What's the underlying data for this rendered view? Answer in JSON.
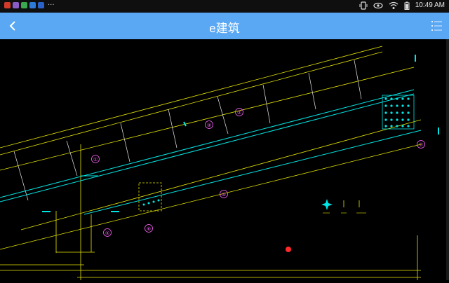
{
  "status_bar": {
    "time": "10:49 AM",
    "overflow": "···",
    "app_icons": [
      "#d23b2a",
      "#8b5cc7",
      "#3aa84f",
      "#2d7bd6",
      "#2a62c9"
    ]
  },
  "app_bar": {
    "title": "e建筑"
  },
  "drawing": {
    "circle_labels": [
      "①",
      "②",
      "③",
      "④",
      "⑤",
      "⑥",
      "⑦"
    ]
  },
  "colors": {
    "app_bar": "#5aa7f4",
    "cad_yellow": "#e6e600",
    "cad_cyan": "#00e6e6",
    "cad_white": "#e8e8e8",
    "cad_magenta": "#ff66ff",
    "marker_red": "#ff2a2a"
  }
}
